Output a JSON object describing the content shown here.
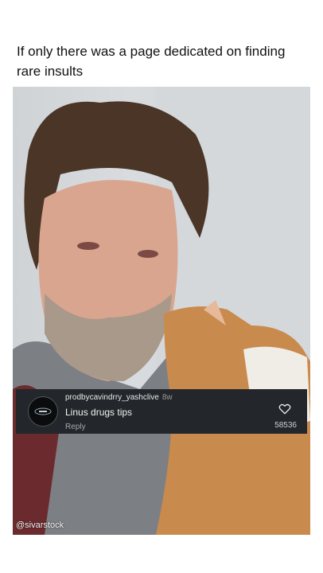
{
  "caption": "If only there was a page dedicated on finding rare insults",
  "comment": {
    "username": "prodbycavindrry_yashclive",
    "time": "8w",
    "text": "Linus drugs tips",
    "reply_label": "Reply",
    "likes": "58536",
    "avatar_icon": "circular-logo-avatar",
    "like_icon": "heart-outline-icon"
  },
  "watermark": "@sivarstock"
}
